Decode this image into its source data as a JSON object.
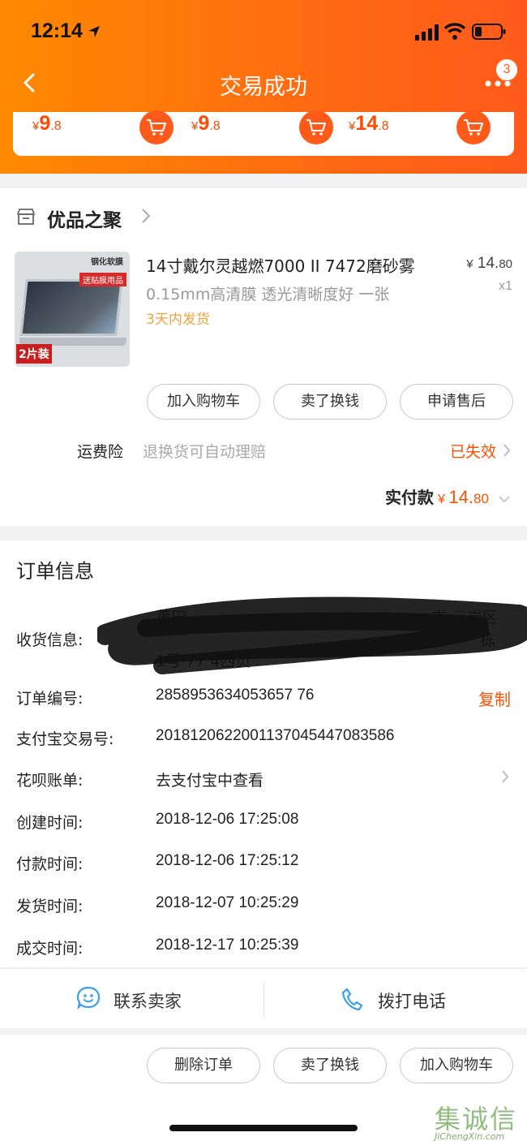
{
  "status_bar": {
    "time": "12:14"
  },
  "nav": {
    "title": "交易成功",
    "badge_count": "3"
  },
  "recommendations": [
    {
      "yen": "¥",
      "int": "9",
      "dec": ".8"
    },
    {
      "yen": "¥",
      "int": "9",
      "dec": ".8"
    },
    {
      "yen": "¥",
      "int": "14",
      "dec": ".8"
    }
  ],
  "shop": {
    "name": "优品之聚",
    "product": {
      "title": "14寸戴尔灵越燃7000 II 7472磨砂雾",
      "spec": "0.15mm高清膜 透光清晰度好 一张",
      "shipping": "3天内发货",
      "price_yen": "¥",
      "price_main": "14.",
      "price_dec": "80",
      "qty": "x1",
      "image_text": {
        "tag1": "钢化软膜",
        "tag2": "送贴膜用品",
        "tag3": "2片装"
      }
    },
    "buttons": {
      "add_cart": "加入购物车",
      "resell": "卖了换钱",
      "after_sale": "申请售后"
    },
    "insurance": {
      "label": "运费险",
      "desc": "退换货可自动理赔",
      "status": "已失效"
    },
    "paid": {
      "label": "实付款",
      "yen": "¥",
      "main": "14.",
      "dec": "80"
    }
  },
  "order": {
    "title": "订单信息",
    "address_label": "收货信息:",
    "address_partial": [
      "莆田",
      "市 元岩区",
      "栋",
      "1号 77 4西贝"
    ],
    "rows": [
      {
        "label": "订单编号:",
        "value": "2858953634053657 76"
      },
      {
        "label": "支付宝交易号:",
        "value": "2018120622001137045447083586"
      },
      {
        "label": "花呗账单:",
        "value": "去支付宝中查看"
      },
      {
        "label": "创建时间:",
        "value": "2018-12-06 17:25:08"
      },
      {
        "label": "付款时间:",
        "value": "2018-12-06 17:25:12"
      },
      {
        "label": "发货时间:",
        "value": "2018-12-07 10:25:29"
      },
      {
        "label": "成交时间:",
        "value": "2018-12-17 10:25:39"
      }
    ],
    "copy_label": "复制"
  },
  "contact": {
    "seller": "联系卖家",
    "call": "拨打电话"
  },
  "bottom_buttons": {
    "delete": "删除订单",
    "resell": "卖了换钱",
    "add_cart": "加入购物车"
  },
  "watermark": {
    "cn": "集诚信",
    "en": "JiChengXin.com"
  },
  "colors": {
    "accent": "#ff5000",
    "header": "#ff7a0a",
    "ship": "#f0a53c",
    "icon_blue": "#3aa0e8"
  }
}
